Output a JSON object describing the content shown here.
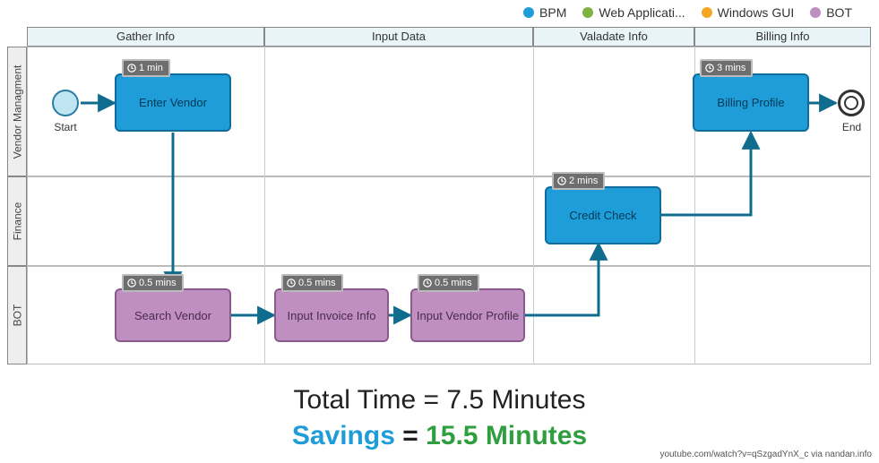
{
  "legend": [
    {
      "label": "BPM",
      "color": "#1f9dd9"
    },
    {
      "label": "Web Applicati...",
      "color": "#7cb342"
    },
    {
      "label": "Windows GUI",
      "color": "#f5a623"
    },
    {
      "label": "BOT",
      "color": "#c08fc2"
    }
  ],
  "phases": [
    {
      "label": "Gather Info"
    },
    {
      "label": "Input Data"
    },
    {
      "label": "Valadate Info"
    },
    {
      "label": "Billing Info"
    }
  ],
  "lanes": [
    {
      "label": "Vendor Managment"
    },
    {
      "label": "Finance"
    },
    {
      "label": "BOT"
    }
  ],
  "events": {
    "start": "Start",
    "end": "End"
  },
  "tasks": {
    "enter_vendor": {
      "label": "Enter Vendor",
      "duration": "1 min",
      "type": "BPM"
    },
    "search_vendor": {
      "label": "Search Vendor",
      "duration": "0.5 mins",
      "type": "BOT"
    },
    "input_invoice": {
      "label": "Input Invoice Info",
      "duration": "0.5 mins",
      "type": "BOT"
    },
    "input_vendor_profile": {
      "label": "Input Vendor Profile",
      "duration": "0.5 mins",
      "type": "BOT"
    },
    "credit_check": {
      "label": "Credit Check",
      "duration": "2 mins",
      "type": "BPM"
    },
    "billing_profile": {
      "label": "Billing Profile",
      "duration": "3 mins",
      "type": "BPM"
    }
  },
  "summary": {
    "total_label": "Total Time",
    "total_value": "7.5 Minutes",
    "savings_label": "Savings",
    "savings_value": "15.5 Minutes"
  },
  "attribution": "youtube.com/watch?v=qSzgadYnX_c via nandan.info",
  "colors": {
    "bpm": "#1f9dd9",
    "bot": "#c08fc2",
    "connector": "#0f6c8c"
  }
}
